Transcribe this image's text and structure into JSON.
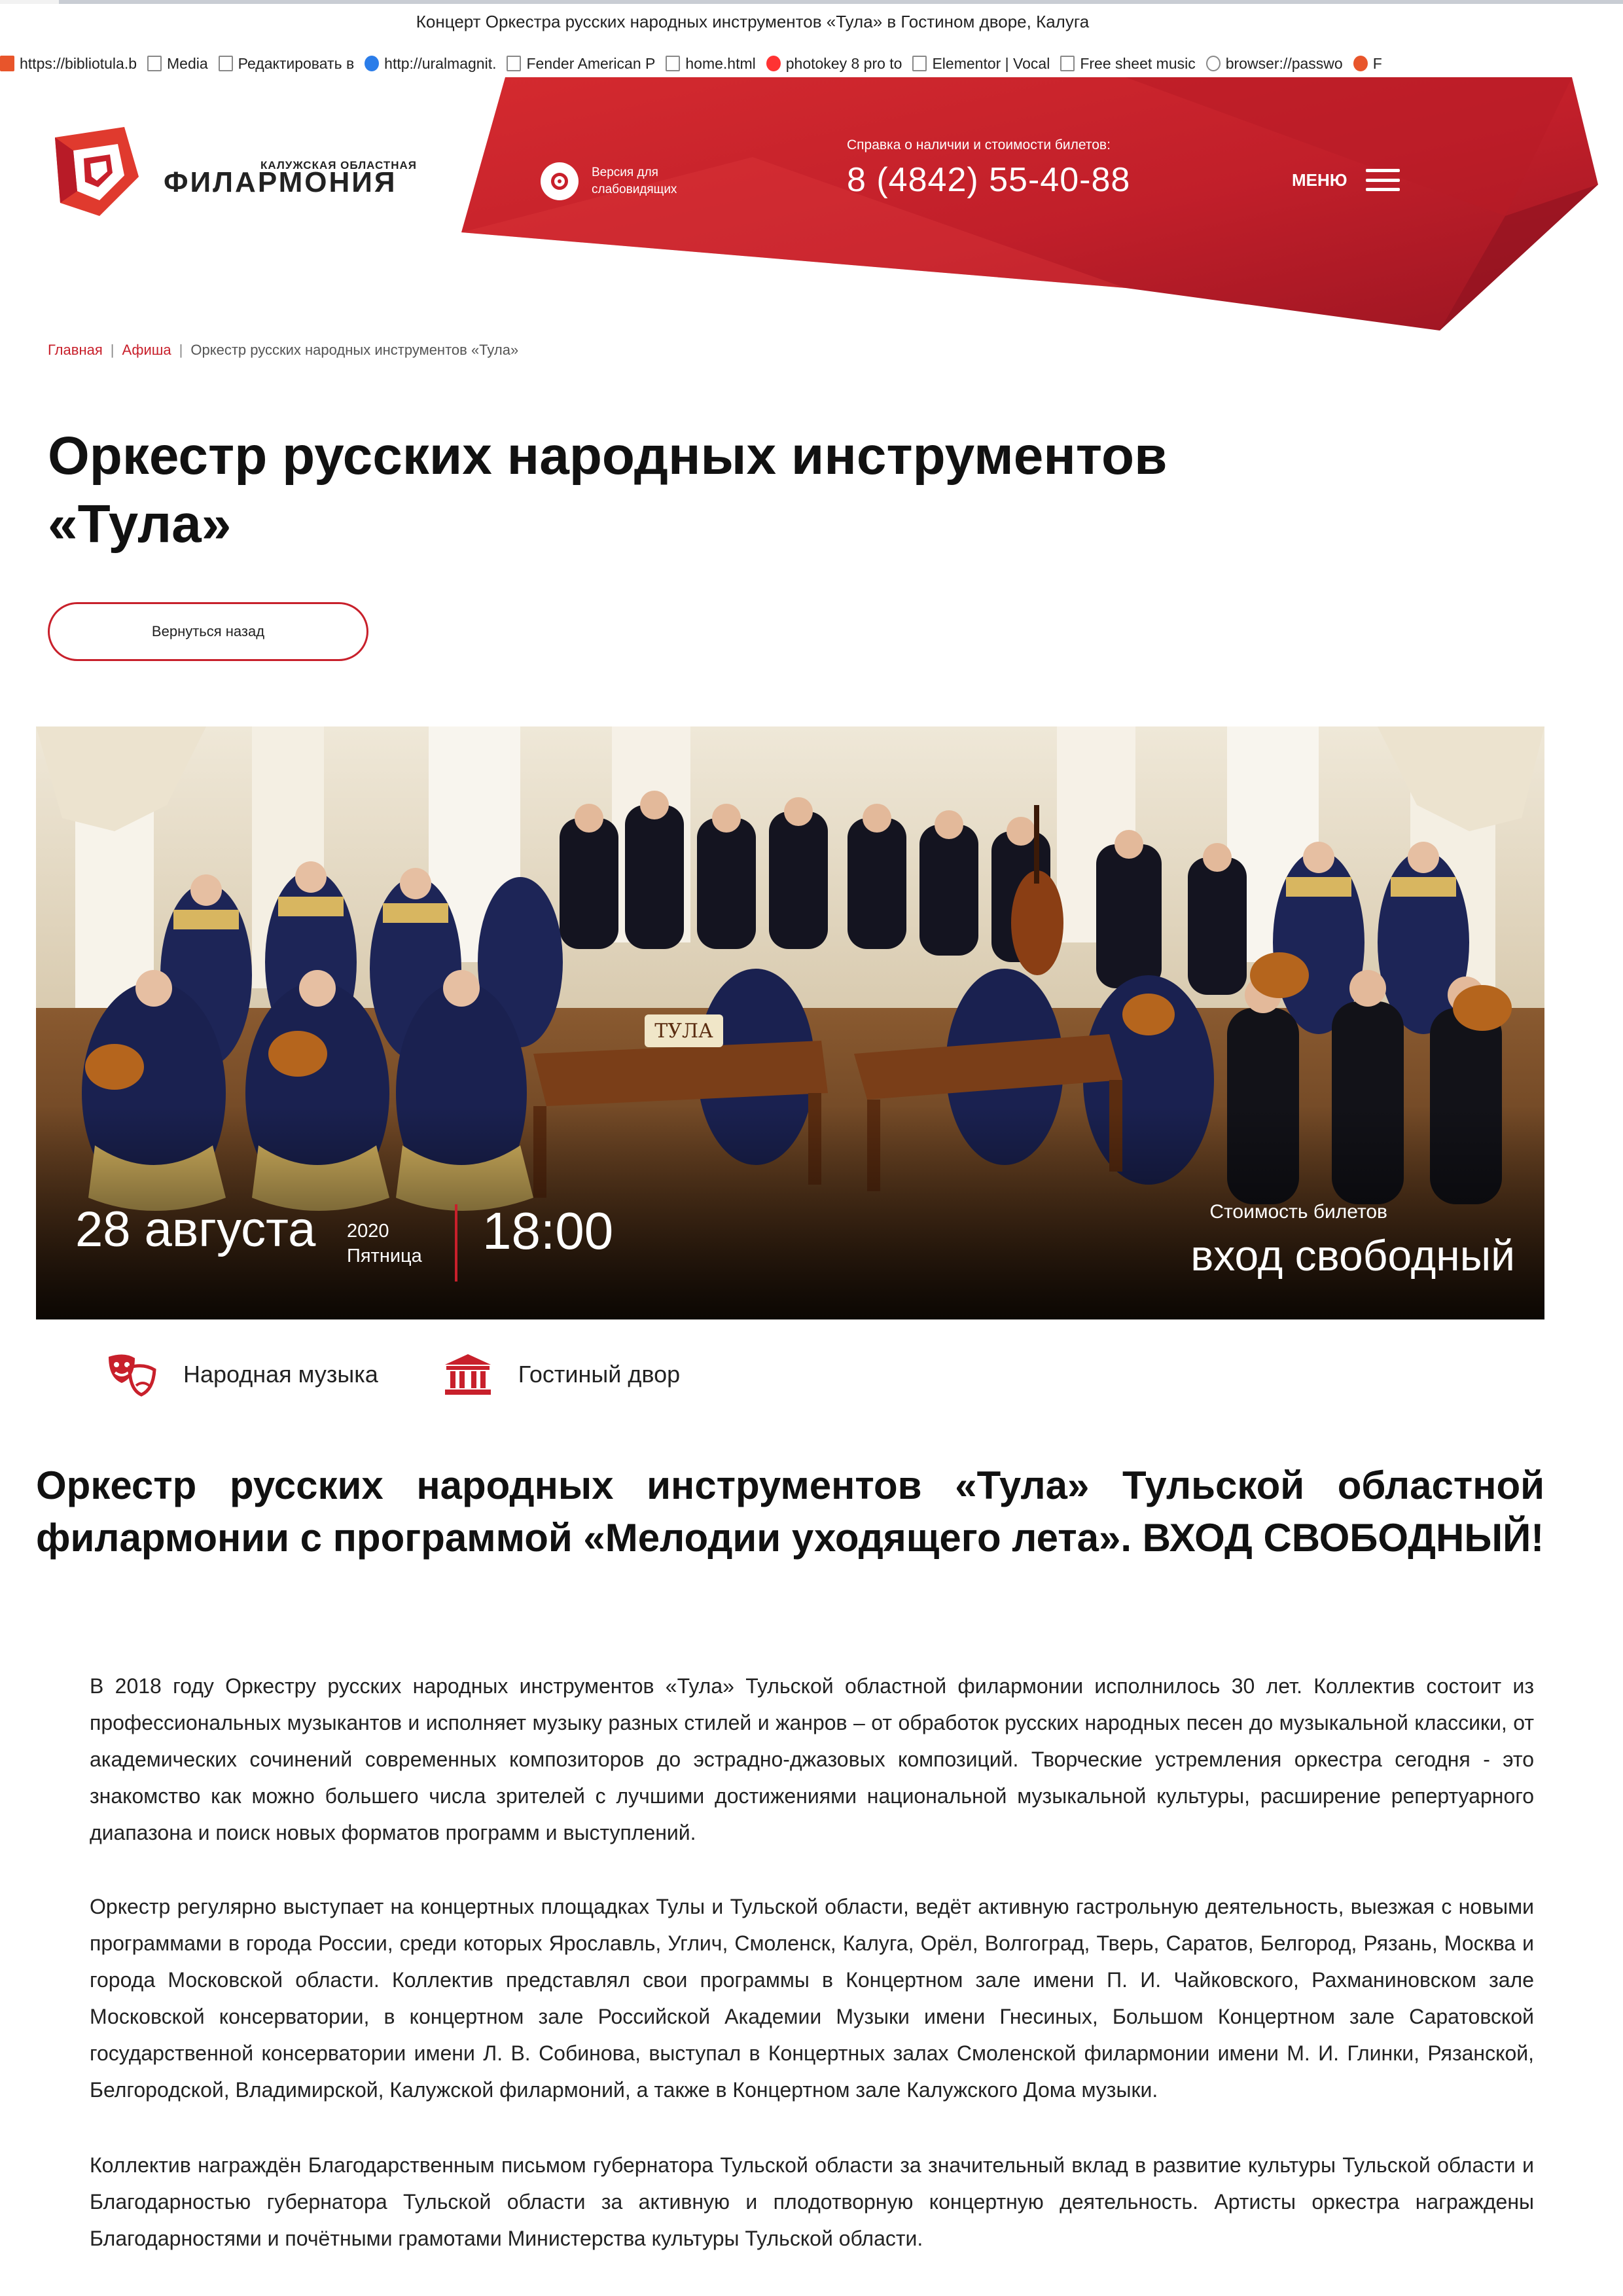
{
  "browser": {
    "window_title": "Концерт Оркестра русских народных инструментов «Тула» в Гостином дворе, Калуга",
    "bookmarks": [
      {
        "label": "https://bibliotula.b",
        "icon": "blogger-icon"
      },
      {
        "label": "Media",
        "icon": "page-icon"
      },
      {
        "label": "Редактировать в",
        "icon": "page-icon"
      },
      {
        "label": "http://uralmagnit.",
        "icon": "globe-icon"
      },
      {
        "label": "Fender American P",
        "icon": "page-icon"
      },
      {
        "label": "home.html",
        "icon": "page-icon"
      },
      {
        "label": "photokey 8 pro to",
        "icon": "yandex-icon"
      },
      {
        "label": "Elementor | Vocal",
        "icon": "page-icon"
      },
      {
        "label": "Free sheet music",
        "icon": "page-icon"
      },
      {
        "label": "browser://passwo",
        "icon": "browser-icon"
      },
      {
        "label": "F",
        "icon": "opera-icon"
      }
    ]
  },
  "header": {
    "logo_small": "Калужская областная",
    "logo_big": "ФИЛАРМОНИЯ",
    "vision_label": "Версия для слабовидящих",
    "phone_label": "Справка о наличии и стоимости билетов:",
    "phone": "8 (4842) 55-40-88",
    "menu_label": "МЕНЮ",
    "accent_color": "#c8202b"
  },
  "breadcrumb": {
    "home": "Главная",
    "afisha": "Афиша",
    "current": "Оркестр русских народных инструментов «Тула»",
    "separator": "|"
  },
  "page": {
    "title": "Оркестр русских народных инструментов «Тула»",
    "back_button": "Вернуться назад"
  },
  "event": {
    "date": "28 августа",
    "year": "2020",
    "weekday": "Пятница",
    "time": "18:00",
    "price_label": "Стоимость билетов",
    "price": "вход свободный"
  },
  "tags": {
    "genre": "Народная музыка",
    "venue": "Гостиный двор"
  },
  "content": {
    "subtitle": "Оркестр русских народных инструментов «Тула» Тульской областной филармонии с программой «Мелодии уходящего лета». ВХОД СВОБОДНЫЙ!",
    "paragraphs": [
      "В 2018 году Оркестру русских народных инструментов «Тула» Тульской областной филармонии исполнилось 30 лет. Коллектив состоит из профессиональных музыкантов и исполняет музыку разных стилей и жанров – от обработок русских народных песен до музыкальной классики, от академических сочинений современных композиторов до эстрадно-джазовых композиций. Творческие устремления оркестра сегодня - это знакомство как можно большего числа зрителей с лучшими достижениями национальной музыкальной культуры, расширение репертуарного диапазона и поиск новых форматов программ и выступлений.",
      "Оркестр регулярно выступает на концертных площадках Тулы и Тульской области, ведёт активную гастрольную деятельность, выезжая с новыми программами в города России, среди которых Ярославль, Углич, Смоленск, Калуга, Орёл, Волгоград, Тверь, Саратов, Белгород, Рязань, Москва и города Московской области. Коллектив представлял свои программы в Концертном зале имени П. И. Чайковского, Рахманиновском зале Московской консерватории, в концертном зале Российской Академии Музыки имени Гнесиных, Большом Концертном зале Саратовской государственной консерватории имени Л. В. Собинова, выступал в Концертных залах Смоленской филармонии имени М. И. Глинки, Рязанской, Белгородской, Владимирской, Калужской филармоний, а также в Концертном зале Калужского Дома музыки.",
      "Коллектив награждён Благодарственным письмом губернатора Тульской области за значительный вклад в развитие культуры Тульской области и Благодарностью губернатора Тульской области за активную и плодотворную концертную деятельность. Артисты оркестра награждены Благодарностями и почётными грамотами Министерства культуры Тульской области."
    ]
  },
  "hero_image": {
    "drum_label": "ТУЛА"
  }
}
